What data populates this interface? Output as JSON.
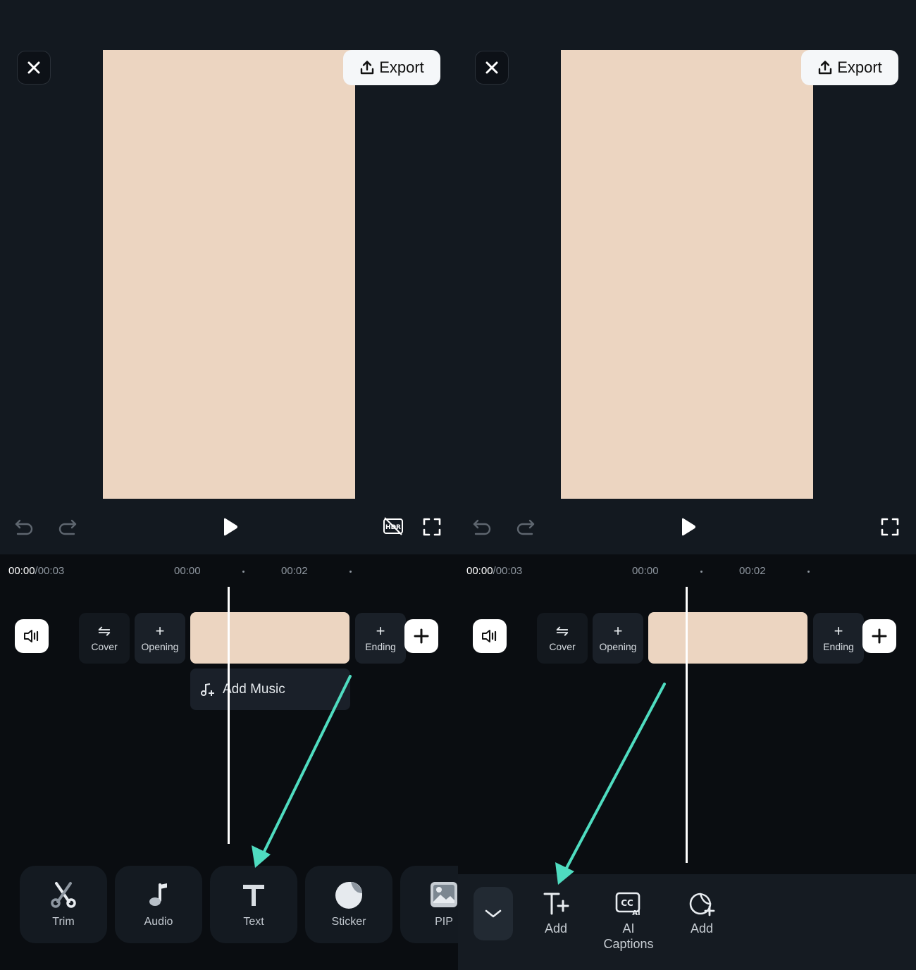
{
  "left": {
    "export_label": "Export",
    "time_current": "00:00",
    "time_total": "/00:03",
    "ticks": [
      "00:00",
      "00:02"
    ],
    "segments": {
      "cover": "Cover",
      "opening": "Opening",
      "ending": "Ending"
    },
    "add_music_label": "Add Music",
    "tools": [
      {
        "label": "Trim",
        "icon": "scissors-icon"
      },
      {
        "label": "Audio",
        "icon": "music-note-icon"
      },
      {
        "label": "Text",
        "icon": "text-icon"
      },
      {
        "label": "Sticker",
        "icon": "sticker-icon"
      },
      {
        "label": "PIP",
        "icon": "picture-in-picture-icon"
      }
    ]
  },
  "right": {
    "export_label": "Export",
    "time_current": "00:00",
    "time_total": "/00:03",
    "ticks": [
      "00:00",
      "00:02"
    ],
    "segments": {
      "cover": "Cover",
      "opening": "Opening",
      "ending": "Ending"
    },
    "text_tools": [
      {
        "label": "Add",
        "icon": "add-text-icon"
      },
      {
        "label": "AI\nCaptions",
        "icon": "ai-captions-icon"
      },
      {
        "label": "Add",
        "icon": "add-sticker-text-icon"
      }
    ]
  },
  "colors": {
    "accent_arrow": "#4fdcc0",
    "canvas": "#ecd5c1",
    "background": "#131920"
  }
}
